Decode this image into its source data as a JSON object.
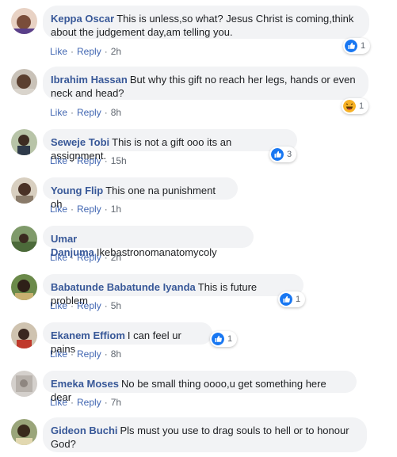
{
  "comments": [
    {
      "name": "Keppa Oscar",
      "text_lines": [
        "This is unless,so what? Jesus Christ is coming,think",
        "about the judgement day,am telling you."
      ],
      "like_label": "Like",
      "reply_label": "Reply",
      "time": "2h",
      "reaction": {
        "icon": "like-icon",
        "count": "1"
      }
    },
    {
      "name": "Ibrahim Hassan",
      "text_lines": [
        "But why this gift no reach her legs, hands or even",
        "neck and head?"
      ],
      "like_label": "Like",
      "reply_label": "Reply",
      "time": "8h",
      "reaction": {
        "icon": "haha-icon",
        "count": "1"
      }
    },
    {
      "name": "Seweje Tobi",
      "text_lines": [
        "This is not a gift ooo its an assignment."
      ],
      "like_label": "Like",
      "reply_label": "Reply",
      "time": "15h",
      "reaction": {
        "icon": "like-icon",
        "count": "3"
      }
    },
    {
      "name": "Young Flip",
      "text_lines": [
        "This one na punishment oh"
      ],
      "like_label": "Like",
      "reply_label": "Reply",
      "time": "1h"
    },
    {
      "name": "Umar Danjuma",
      "text_lines": [
        "Ikebastronomanatomycoly"
      ],
      "like_label": "Like",
      "reply_label": "Reply",
      "time": "2h"
    },
    {
      "name": "Babatunde Babatunde Iyanda",
      "text_lines": [
        "This is future problem"
      ],
      "like_label": "Like",
      "reply_label": "Reply",
      "time": "5h",
      "reaction": {
        "icon": "like-icon",
        "count": "1"
      }
    },
    {
      "name": "Ekanem Effiom",
      "text_lines": [
        "I can feel ur pains"
      ],
      "like_label": "Like",
      "reply_label": "Reply",
      "time": "8h",
      "reaction": {
        "icon": "like-icon",
        "count": "1"
      }
    },
    {
      "name": "Emeka Moses",
      "text_lines": [
        "No be small thing oooo,u get something here dear"
      ],
      "like_label": "Like",
      "reply_label": "Reply",
      "time": "7h"
    },
    {
      "name": "Gideon Buchi",
      "text_lines": [
        "Pls must you use to drag souls to hell or to honour",
        "God?"
      ]
    }
  ],
  "separator": "·",
  "colors": {
    "name": "#385898",
    "link": "#4267b2",
    "bubble": "#f2f3f5",
    "like": "#1877f2",
    "haha": "#f7b125"
  }
}
